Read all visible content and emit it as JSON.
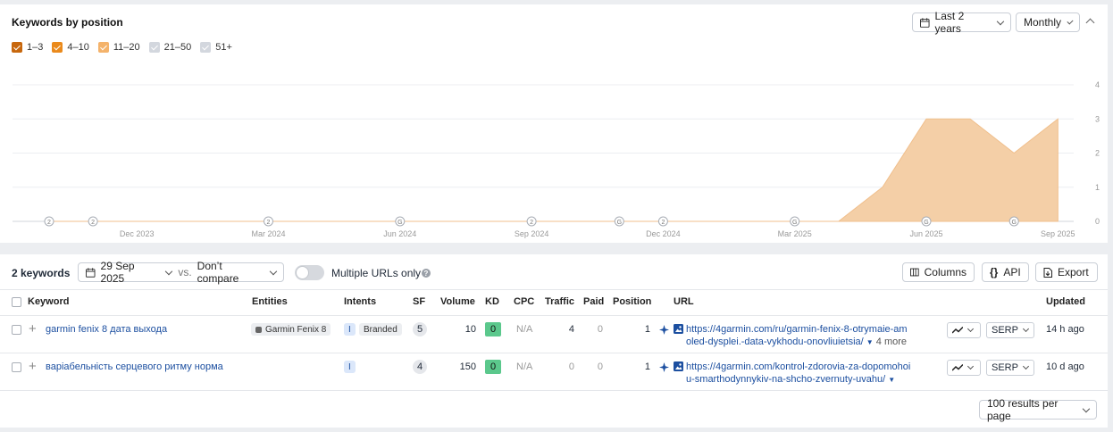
{
  "chart_card": {
    "title": "Keywords by position",
    "period_label": "Last 2 years",
    "interval_label": "Monthly",
    "legend": [
      {
        "label": "1–3",
        "color": "#c7670d",
        "checked": true
      },
      {
        "label": "4–10",
        "color": "#ea8a1c",
        "checked": true
      },
      {
        "label": "11–20",
        "color": "#f4b36b",
        "checked": true
      },
      {
        "label": "21–50",
        "color": "#d3d7de",
        "checked": false
      },
      {
        "label": "51+",
        "color": "#d3d7de",
        "checked": false
      }
    ]
  },
  "chart_data": {
    "type": "area",
    "x_ticks": [
      "Dec 2023",
      "Mar 2024",
      "Jun 2024",
      "Sep 2024",
      "Dec 2024",
      "Mar 2025",
      "Jun 2025",
      "Sep 2025"
    ],
    "y_ticks": [
      0,
      1,
      2,
      3,
      4
    ],
    "ylim": [
      0,
      4
    ],
    "series": [
      {
        "color": "#f4cfa7",
        "points": [
          {
            "x": "Oct 2023",
            "y": 0
          },
          {
            "x": "Nov 2023",
            "y": 0
          },
          {
            "x": "Dec 2023",
            "y": 0
          },
          {
            "x": "Jan 2024",
            "y": 0
          },
          {
            "x": "Feb 2024",
            "y": 0
          },
          {
            "x": "Mar 2024",
            "y": 0
          },
          {
            "x": "Apr 2024",
            "y": 0
          },
          {
            "x": "May 2024",
            "y": 0
          },
          {
            "x": "Jun 2024",
            "y": 0
          },
          {
            "x": "Jul 2024",
            "y": 0
          },
          {
            "x": "Aug 2024",
            "y": 0
          },
          {
            "x": "Sep 2024",
            "y": 0
          },
          {
            "x": "Oct 2024",
            "y": 0
          },
          {
            "x": "Nov 2024",
            "y": 0
          },
          {
            "x": "Dec 2024",
            "y": 0
          },
          {
            "x": "Jan 2025",
            "y": 0
          },
          {
            "x": "Feb 2025",
            "y": 0
          },
          {
            "x": "Mar 2025",
            "y": 0
          },
          {
            "x": "Mid Apr 2025",
            "y": 0
          },
          {
            "x": "May 2025",
            "y": 1
          },
          {
            "x": "Jun 2025",
            "y": 3
          },
          {
            "x": "Jul 2025",
            "y": 3
          },
          {
            "x": "Aug 2025",
            "y": 2
          },
          {
            "x": "Sep 2025",
            "y": 3
          }
        ]
      }
    ],
    "markers": [
      {
        "x": "Oct 2023",
        "label": "2"
      },
      {
        "x": "Nov 2023",
        "label": "2"
      },
      {
        "x": "Mar 2024",
        "label": "2"
      },
      {
        "x": "Jun 2024",
        "label": "G"
      },
      {
        "x": "Sep 2024",
        "label": "2"
      },
      {
        "x": "Nov 2024",
        "label": "G"
      },
      {
        "x": "Dec 2024",
        "label": "2"
      },
      {
        "x": "Mar 2025",
        "label": "G"
      },
      {
        "x": "Jun 2025",
        "label": "G"
      },
      {
        "x": "Aug 2025",
        "label": "G"
      }
    ]
  },
  "table_card": {
    "count_label": "2 keywords",
    "date_label": "29 Sep 2025",
    "vs_label": "vs.",
    "compare_label": "Don’t compare",
    "multiple_urls_label": "Multiple URLs only",
    "columns_button": "Columns",
    "api_button": "API",
    "export_button": "Export",
    "headers": {
      "keyword": "Keyword",
      "entities": "Entities",
      "intents": "Intents",
      "sf": "SF",
      "volume": "Volume",
      "kd": "KD",
      "cpc": "CPC",
      "traffic": "Traffic",
      "paid": "Paid",
      "position": "Position",
      "url": "URL",
      "updated": "Updated"
    },
    "rows": [
      {
        "keyword": "garmin fenix 8 дата выхода",
        "entity": "Garmin Fenix 8",
        "intent_i": "I",
        "intent_branded": "Branded",
        "sf": "5",
        "volume": "10",
        "kd": "0",
        "cpc": "N/A",
        "traffic": "4",
        "paid": "0",
        "position": "1",
        "url_line1": "https://4garmin.com/ru/garmin-fenix-8-otrymaie-am",
        "url_line2": "oled-dysplei.-data-vykhodu-onovliuietsia/",
        "url_more": "4 more",
        "serp": "SERP",
        "updated": "14 h ago"
      },
      {
        "keyword": "варіабельність серцевого ритму норма",
        "intent_i": "I",
        "sf": "4",
        "volume": "150",
        "kd": "0",
        "cpc": "N/A",
        "traffic": "0",
        "paid": "0",
        "position": "1",
        "url_line1": "https://4garmin.com/kontrol-zdorovia-za-dopomohoi",
        "url_line2": "u-smarthodynnykiv-na-shcho-zvernuty-uvahu/",
        "serp": "SERP",
        "updated": "10 d ago"
      }
    ],
    "per_page_label": "100 results per page"
  }
}
